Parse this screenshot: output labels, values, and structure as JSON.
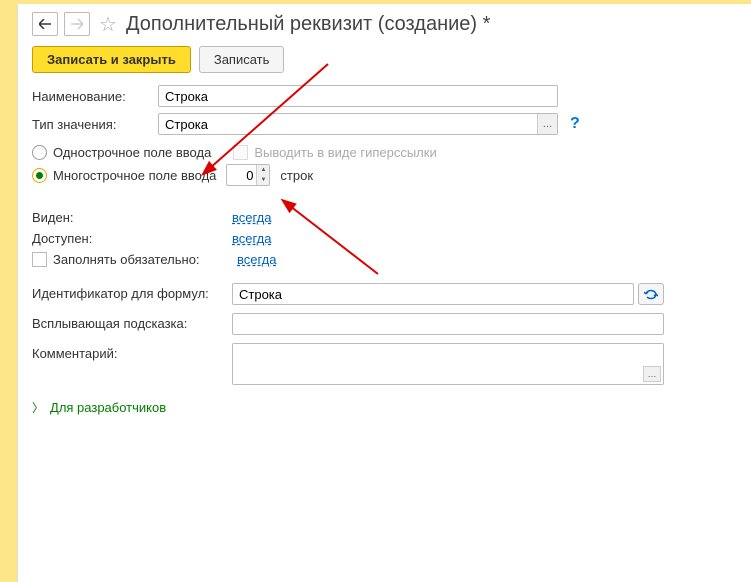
{
  "header": {
    "title": "Дополнительный реквизит (создание) *"
  },
  "toolbar": {
    "primary": "Записать и закрыть",
    "secondary": "Записать"
  },
  "fields": {
    "name_label": "Наименование:",
    "name_value": "Строка",
    "type_label": "Тип значения:",
    "type_value": "Строка",
    "help": "?"
  },
  "radios": {
    "single_line": "Однострочное поле ввода",
    "multi_line": "Многострочное поле ввода",
    "as_link": "Выводить в виде гиперссылки",
    "lines_value": "0",
    "lines_suffix": "строк"
  },
  "visibility": {
    "visible_label": "Виден:",
    "visible_link": "всегда",
    "avail_label": "Доступен:",
    "avail_link": "всегда",
    "required_label": "Заполнять обязательно:",
    "required_link": "всегда"
  },
  "identifier": {
    "label": "Идентификатор для формул:",
    "value": "Строка"
  },
  "tooltip": {
    "label": "Всплывающая подсказка:"
  },
  "comment": {
    "label": "Комментарий:"
  },
  "developers": {
    "label": "Для разработчиков"
  }
}
